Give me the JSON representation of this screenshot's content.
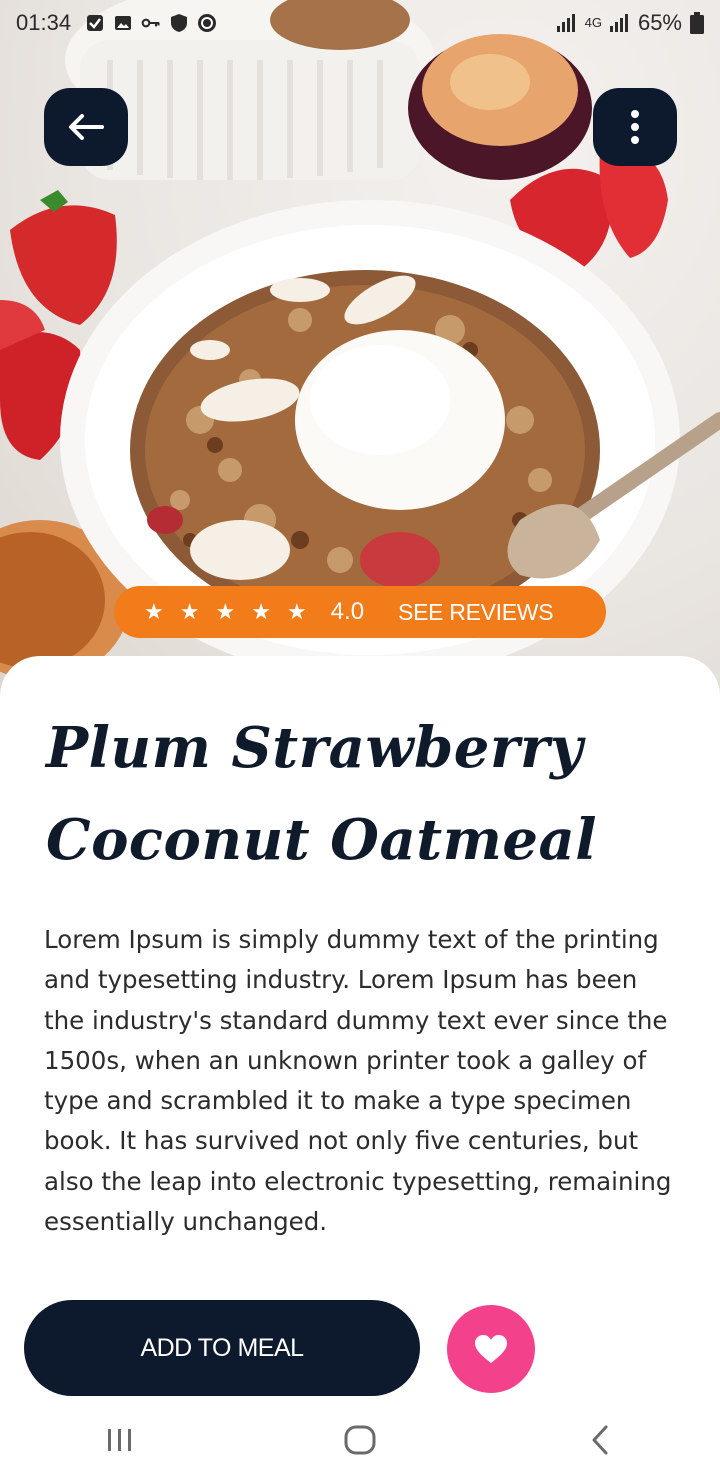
{
  "status_bar": {
    "time": "01:34",
    "network": "4G",
    "battery": "65%",
    "icons": [
      "checkbox-icon",
      "gallery-icon",
      "key-icon",
      "shield-icon",
      "sync-icon",
      "signal-icon",
      "signal-icon",
      "battery-icon"
    ]
  },
  "header": {
    "back_icon": "arrow-left-icon",
    "menu_icon": "more-vertical-icon"
  },
  "rating": {
    "stars": 5,
    "value": "4.0",
    "see_reviews": "SEE REVIEWS",
    "color": "#f27b1a"
  },
  "recipe": {
    "title": "Plum Strawberry Coconut Oatmeal",
    "description": "Lorem Ipsum is simply dummy text of the printing and typesetting industry. Lorem Ipsum has been the industry's standard dummy text ever since the 1500s, when an unknown printer took a galley of type and scrambled it to make a type specimen book. It has survived not only five centuries, but also the leap into electronic typesetting, remaining essentially unchanged."
  },
  "actions": {
    "add_to_meal": "ADD TO MEAL",
    "favorite_icon": "heart-icon",
    "primary_color": "#0d1a2d",
    "favorite_color": "#f4418c"
  },
  "nav": {
    "items": [
      "recent-apps-icon",
      "home-icon",
      "back-icon"
    ]
  }
}
